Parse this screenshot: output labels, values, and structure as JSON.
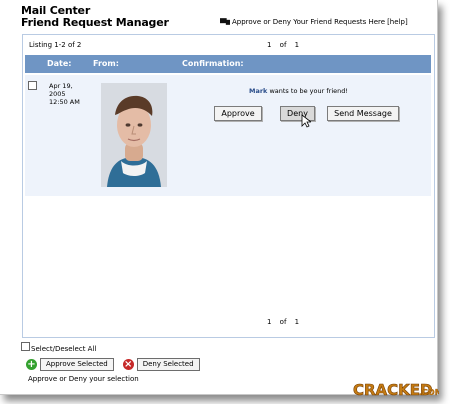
{
  "header": {
    "title_line1": "Mail Center",
    "title_line2": "Friend Request Manager",
    "instruction": "Approve or Deny Your Friend Requests Here",
    "help_label": "[help]"
  },
  "listing": {
    "text": "Listing 1-2 of 2",
    "pagination_top": "1 of 1",
    "pagination_bottom": "1 of 1"
  },
  "table": {
    "columns": [
      "Date:",
      "From:",
      "Confirmation:"
    ],
    "rows": [
      {
        "date_line1": "Apr 19,",
        "date_line2": "2005",
        "date_line3": "12:50 AM",
        "sender": "Mark",
        "message": "wants to be your friend!",
        "approve_label": "Approve",
        "deny_label": "Deny",
        "send_message_label": "Send Message"
      }
    ]
  },
  "footer": {
    "select_all_label": "Select/Deselect All",
    "approve_selected_label": "Approve Selected",
    "deny_selected_label": "Deny Selected",
    "note": "Approve or Deny your selection"
  },
  "watermark": {
    "text": "CRACKED.COM"
  },
  "colors": {
    "header_blue": "#6f95c4",
    "row_bg": "#eef3fb",
    "approve_green": "#34a12f",
    "deny_red": "#c62828"
  }
}
